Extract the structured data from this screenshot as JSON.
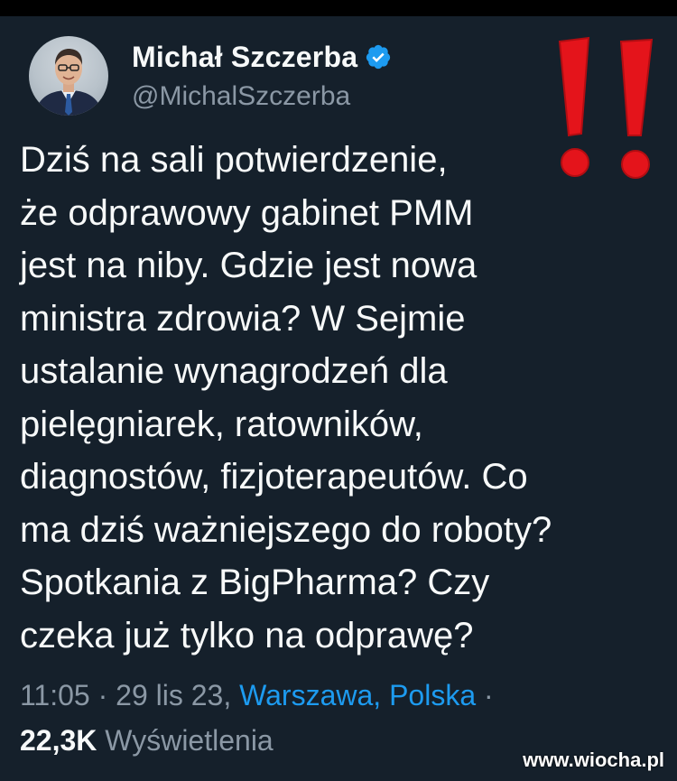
{
  "author": {
    "display_name": "Michał Szczerba",
    "handle": "@MichalSzczerba",
    "verified_icon": "verified-badge-icon"
  },
  "overlay_icon": "double-exclamation-icon",
  "tweet": {
    "lines": [
      "Dziś na sali potwierdzenie,",
      "że odprawowy gabinet PMM",
      "jest na niby. Gdzie jest nowa",
      "ministra zdrowia? W Sejmie",
      "ustalanie wynagrodzeń dla",
      "pielęgniarek, ratowników,",
      "diagnostów, fizjoterapeutów. Co",
      "ma dziś ważniejszego do roboty?",
      "Spotkania z BigPharma? Czy",
      "czeka już tylko na odprawę?"
    ]
  },
  "meta": {
    "time": "11:05",
    "separator": "·",
    "date": "29 lis 23,",
    "location": "Warszawa, Polska",
    "trailing_separator": "·"
  },
  "views": {
    "count": "22,3K",
    "label": "Wyświetlenia"
  },
  "watermark": "www.wiocha.pl",
  "colors": {
    "background": "#15202b",
    "text": "#f7f9f9",
    "secondary": "#8b98a5",
    "link": "#1d9bf0",
    "verified": "#1d9bf0",
    "alarm": "#e4141b"
  }
}
